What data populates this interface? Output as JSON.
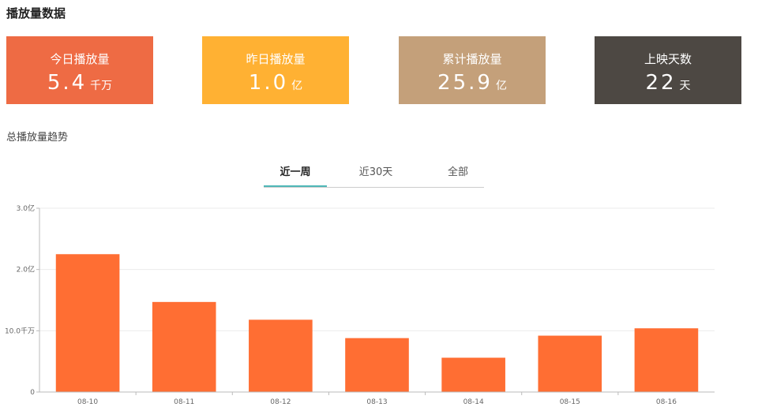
{
  "page_title": "播放量数据",
  "cards": [
    {
      "label": "今日播放量",
      "value": "5.4",
      "unit": "千万",
      "color": "#ee6b44"
    },
    {
      "label": "昨日播放量",
      "value": "1.0",
      "unit": "亿",
      "color": "#ffb133"
    },
    {
      "label": "累计播放量",
      "value": "25.9",
      "unit": "亿",
      "color": "#c4a07a"
    },
    {
      "label": "上映天数",
      "value": "22",
      "unit": "天",
      "color": "#4d4843"
    }
  ],
  "trend_title": "总播放量趋势",
  "tabs": [
    {
      "label": "近一周",
      "active": true
    },
    {
      "label": "近30天",
      "active": false
    },
    {
      "label": "全部",
      "active": false
    }
  ],
  "chart_data": {
    "type": "bar",
    "categories": [
      "08-10",
      "08-11",
      "08-12",
      "08-13",
      "08-14",
      "08-15",
      "08-16"
    ],
    "values": [
      2.25,
      1.47,
      1.18,
      0.88,
      0.56,
      0.92,
      1.04
    ],
    "ylim": [
      0,
      3
    ],
    "yticks": [
      0,
      1,
      2,
      3
    ],
    "ytick_labels": [
      "0",
      "10.0千万",
      "2.0亿",
      "3.0亿"
    ],
    "xlabel": "",
    "ylabel": "",
    "grid": true,
    "bar_color": "#ff6e33",
    "accent_color": "#4fb8b8"
  }
}
